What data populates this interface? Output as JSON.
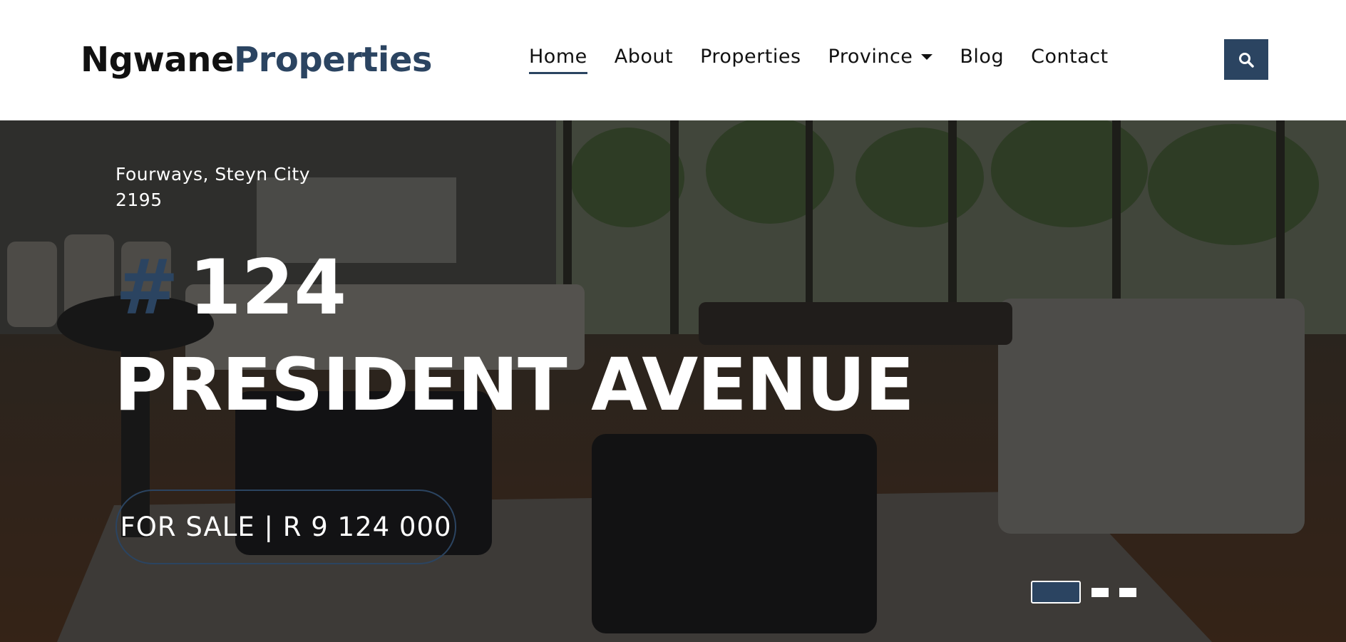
{
  "brand": {
    "part1": "Ngwane",
    "part2": "Properties"
  },
  "nav": {
    "items": [
      {
        "label": "Home",
        "active": true
      },
      {
        "label": "About"
      },
      {
        "label": "Properties"
      },
      {
        "label": "Province",
        "dropdown": true
      },
      {
        "label": "Blog"
      },
      {
        "label": "Contact"
      }
    ],
    "search_icon": "search-icon"
  },
  "hero": {
    "location_line1": "Fourways, Steyn City",
    "location_line2": "2195",
    "hash": "#",
    "number": "124",
    "street": "PRESIDENT AVENUE",
    "price": "FOR SALE | R 9 124 000",
    "slides": {
      "count": 3,
      "active": 1
    }
  },
  "colors": {
    "accent": "#2b4461",
    "nav_text": "#111111",
    "hero_text": "#ffffff"
  }
}
